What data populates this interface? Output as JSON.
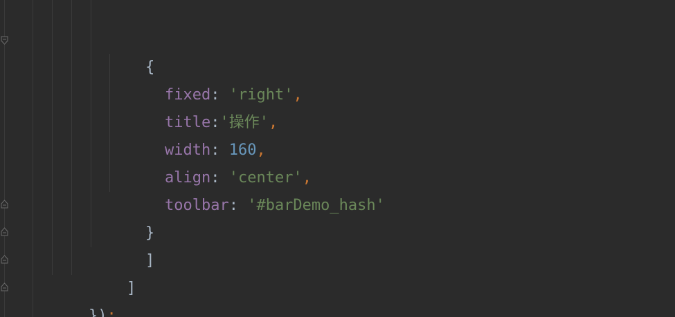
{
  "code": {
    "open_brace": "{",
    "lines": [
      {
        "key": "fixed",
        "sep": ": ",
        "value": "'right'",
        "value_type": "str",
        "trail": ","
      },
      {
        "key": "title",
        "sep": ":",
        "value": "'操作'",
        "value_type": "str",
        "trail": ","
      },
      {
        "key": "width",
        "sep": ": ",
        "value": "160",
        "value_type": "num",
        "trail": ","
      },
      {
        "key": "align",
        "sep": ": ",
        "value": "'center'",
        "value_type": "str",
        "trail": ","
      },
      {
        "key": "toolbar",
        "sep": ": ",
        "value": "'#barDemo_hash'",
        "value_type": "str",
        "trail": ""
      }
    ],
    "close_brace": "}",
    "close_bracket_inner": "]",
    "close_bracket_outer": "]",
    "close_call": "})",
    "close_semicolon": ";"
  },
  "colors": {
    "background": "#2b2b2b",
    "punctuation": "#a9b7c6",
    "property": "#9876aa",
    "string": "#6a8759",
    "number": "#6897bb",
    "keyword_comma": "#cc7832"
  },
  "gutter": {
    "fold_icons": [
      "fold-collapse-icon",
      "fold-expand-icon",
      "fold-expand-icon",
      "fold-expand-icon",
      "fold-expand-icon"
    ]
  }
}
